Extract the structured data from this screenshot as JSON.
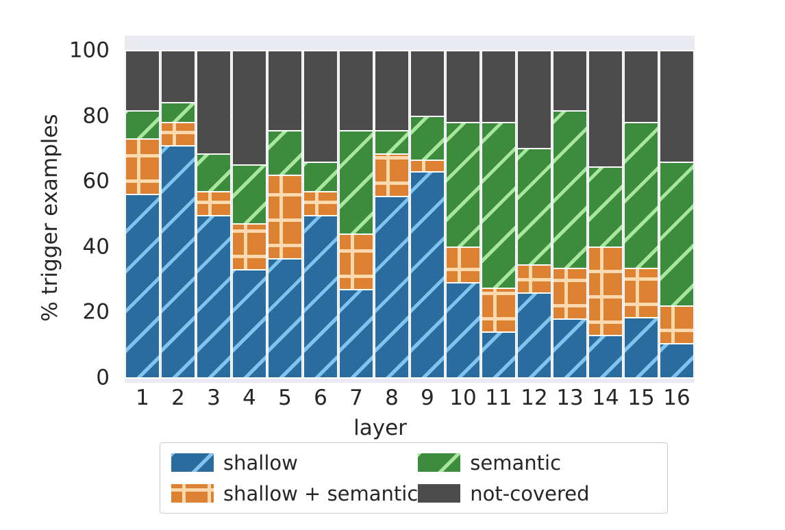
{
  "chart_data": {
    "type": "bar",
    "subtype": "stacked-bar-100pct",
    "title": "",
    "xlabel": "layer",
    "ylabel": "% trigger examples",
    "categories": [
      "1",
      "2",
      "3",
      "4",
      "5",
      "6",
      "7",
      "8",
      "9",
      "10",
      "11",
      "12",
      "13",
      "14",
      "15",
      "16"
    ],
    "ylim": [
      0,
      100
    ],
    "yticks": [
      0,
      20,
      40,
      60,
      80,
      100
    ],
    "ytick_labels": [
      "0",
      "20",
      "40",
      "60",
      "80",
      "100"
    ],
    "grid": true,
    "grid_axis": "y",
    "legend_position": "below-axes",
    "legend_ncol": 2,
    "series": [
      {
        "name": "shallow",
        "color": "#2b6c9e",
        "hatch": "/",
        "values": [
          56,
          71,
          49.5,
          33,
          36.5,
          49.5,
          27,
          55.5,
          63,
          29,
          14,
          26,
          18,
          13,
          18.5,
          10.5
        ]
      },
      {
        "name": "shallow + semantic",
        "color": "#dd8233",
        "hatch": "+",
        "values": [
          17,
          7,
          7.5,
          14,
          25.5,
          7.5,
          17,
          13,
          3.5,
          11,
          13.5,
          8.5,
          15.5,
          27,
          15,
          11.5
        ]
      },
      {
        "name": "semantic",
        "color": "#3d8b3d",
        "hatch": "/",
        "values": [
          8.5,
          6,
          11.5,
          18,
          13.5,
          9,
          31.5,
          7,
          13.5,
          38,
          50.5,
          35.5,
          48,
          24.5,
          44.5,
          44
        ]
      },
      {
        "name": "not-covered",
        "color": "#4c4c4c",
        "hatch": "",
        "values": [
          18.5,
          16,
          31.5,
          35,
          24.5,
          34,
          24.5,
          24.5,
          20,
          22,
          22,
          30,
          18.5,
          35.5,
          22,
          34
        ]
      }
    ],
    "cumulative_tops": {
      "shallow": [
        56,
        71,
        49.5,
        33,
        36.5,
        49.5,
        27,
        55.5,
        63,
        29,
        14,
        26,
        18,
        13,
        18.5,
        10.5
      ],
      "shallow_plus": [
        73,
        78,
        57,
        47,
        62,
        57,
        44,
        68.5,
        66.5,
        40,
        27.5,
        34.5,
        33.5,
        40,
        33.5,
        22
      ],
      "semantic_top": [
        81.5,
        84,
        68.5,
        65,
        75.5,
        66,
        75.5,
        75.5,
        80,
        78,
        78,
        70,
        81.5,
        64.5,
        78,
        66
      ],
      "total": [
        100,
        100,
        100,
        100,
        100,
        100,
        100,
        100,
        100,
        100,
        100,
        100,
        100,
        100,
        100,
        100
      ]
    },
    "legend_entries": [
      {
        "label": "shallow",
        "color": "#2b6c9e",
        "hatch": "/"
      },
      {
        "label": "semantic",
        "color": "#3d8b3d",
        "hatch": "/"
      },
      {
        "label": "shallow + semantic",
        "color": "#dd8233",
        "hatch": "+"
      },
      {
        "label": "not-covered",
        "color": "#4c4c4c",
        "hatch": ""
      }
    ],
    "colors": {
      "shallow": "#2b6c9e",
      "shallow_plus_semantic": "#dd8233",
      "semantic": "#3d8b3d",
      "not_covered": "#4c4c4c",
      "axes_background": "#eaeaf2",
      "gridline": "#ffffff",
      "figure_background": "#ffffff",
      "tick_text": "#262626"
    }
  }
}
